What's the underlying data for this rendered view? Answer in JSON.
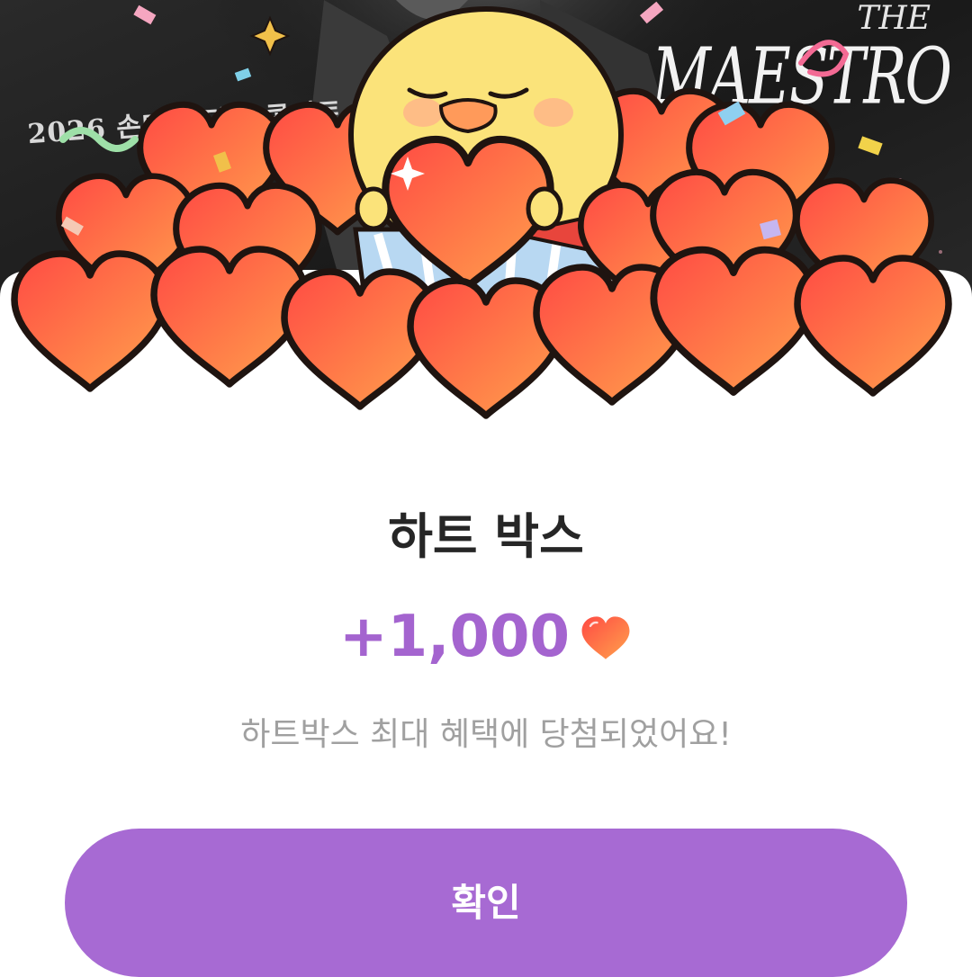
{
  "banner": {
    "poster_caption": "2026 손태진 단독 콘서트",
    "poster_logo": "MAESTRO",
    "poster_logo_prefix": "THE"
  },
  "popup": {
    "title": "하트 박스",
    "reward_amount": "+1,000",
    "reward_icon": "heart-icon",
    "message": "하트박스 최대 혜택에 당첨되었어요!",
    "confirm_label": "확인"
  },
  "colors": {
    "accent": "#a76ad3",
    "reward_text": "#a464cf",
    "heart_top": "#ff5a4a",
    "heart_bottom": "#ff9a4a",
    "chick": "#fbe37a"
  }
}
